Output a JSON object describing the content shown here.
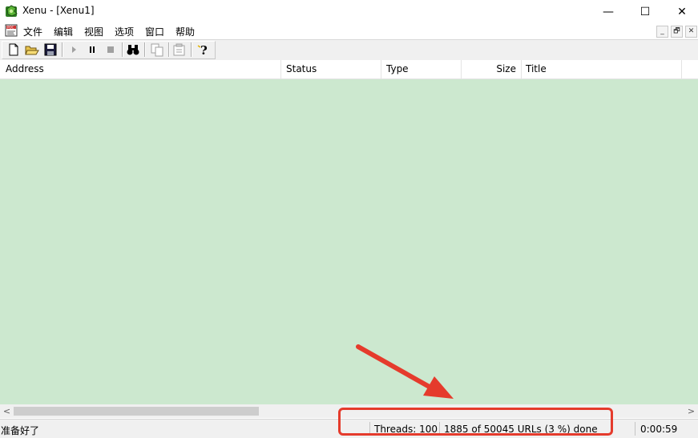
{
  "window": {
    "title": "Xenu - [Xenu1]",
    "minimize_glyph": "—",
    "maximize_glyph": "☐",
    "close_glyph": "✕"
  },
  "menu": {
    "items": [
      "文件",
      "编辑",
      "视图",
      "选项",
      "窗口",
      "帮助"
    ],
    "mdi_buttons": [
      "_",
      "🗗",
      "✕"
    ]
  },
  "toolbar": {
    "buttons": [
      "new-document-icon",
      "open-folder-icon",
      "save-icon",
      "start-icon",
      "pause-icon",
      "stop-icon",
      "find-binoculars-icon",
      "copy-icon",
      "properties-icon",
      "help-icon"
    ]
  },
  "list": {
    "columns": [
      "Address",
      "Status",
      "Type",
      "Size",
      "Title"
    ],
    "background": "#cce8cf"
  },
  "scrollbar": {
    "left_arrow": "<",
    "right_arrow": ">"
  },
  "status": {
    "message": "准备好了",
    "threads": "Threads: 100",
    "progress": "1885 of 50045 URLs (3 %) done",
    "elapsed": "0:00:59"
  },
  "annotation": {
    "color": "#e53b2c"
  }
}
